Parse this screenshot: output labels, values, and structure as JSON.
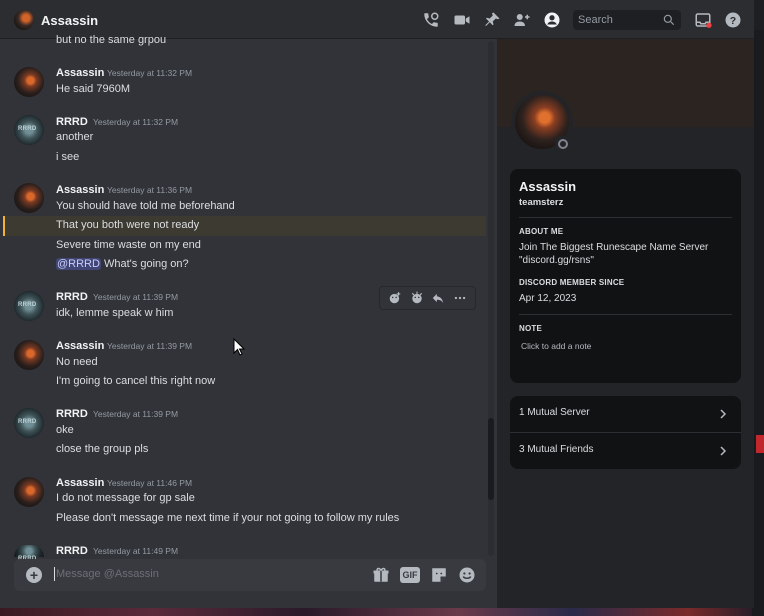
{
  "header": {
    "title": "Assassin",
    "search_placeholder": "Search"
  },
  "messages": {
    "top_cut": "but no the same grpou",
    "g1": {
      "author": "Assassin",
      "time": "Yesterday at 11:32 PM",
      "lines": [
        "He said 7960M"
      ]
    },
    "g2": {
      "author": "RRRD",
      "time": "Yesterday at 11:32 PM",
      "lines": [
        "another",
        "i see"
      ]
    },
    "g3": {
      "author": "Assassin",
      "time": "Yesterday at 11:36 PM",
      "lines": [
        "You should have told me beforehand",
        "That you both were not ready",
        "Severe time waste on my end"
      ],
      "mention": "@RRRD",
      "mention_rest": " What's going on?"
    },
    "g4": {
      "author": "RRRD",
      "time": "Yesterday at 11:39 PM",
      "lines": [
        "idk, lemme speak w him"
      ]
    },
    "g5": {
      "author": "Assassin",
      "time": "Yesterday at 11:39 PM",
      "lines": [
        "No need",
        "I'm going to cancel this right now"
      ]
    },
    "g6": {
      "author": "RRRD",
      "time": "Yesterday at 11:39 PM",
      "lines": [
        "oke",
        "close the group pls"
      ]
    },
    "g7": {
      "author": "Assassin",
      "time": "Yesterday at 11:46 PM",
      "lines": [
        "I do not message for gp sale",
        "Please don't message me next time if your not going to follow my rules"
      ]
    },
    "g8": {
      "author": "RRRD",
      "time": "Yesterday at 11:49 PM"
    }
  },
  "composer": {
    "placeholder": "Message @Assassin",
    "gif_label": "GIF"
  },
  "profile": {
    "display_name": "Assassin",
    "username": "teamsterz",
    "about_heading": "ABOUT ME",
    "about_text_1": "Join The Biggest Runescape Name Server",
    "about_text_2": "\"discord.gg/rsns\"",
    "member_heading": "DISCORD MEMBER SINCE",
    "member_date": "Apr 12, 2023",
    "note_heading": "NOTE",
    "note_placeholder": "Click to add a note",
    "mutual_servers": "1 Mutual Server",
    "mutual_friends": "3 Mutual Friends"
  },
  "colors": {
    "accent_mention_bg": "#414675",
    "highlight_border": "#f0b232",
    "background": "#313338",
    "sidebar": "#232428"
  },
  "icons": [
    "call-icon",
    "video-icon",
    "pin-icon",
    "add-friend-icon",
    "profile-toggle-icon",
    "search-icon",
    "inbox-icon",
    "help-icon",
    "add-reaction-icon",
    "super-reaction-icon",
    "reply-icon",
    "more-icon",
    "gift-icon",
    "gif-icon",
    "sticker-icon",
    "emoji-icon",
    "chevron-right-icon"
  ]
}
